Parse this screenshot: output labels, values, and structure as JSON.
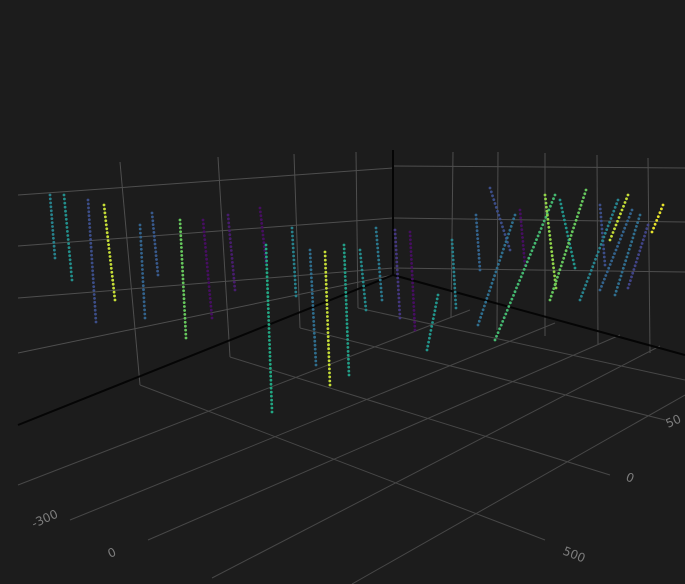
{
  "chart_data": {
    "type": "scatter3d",
    "title": "",
    "background_color": "#1c1c1c",
    "grid": true,
    "colorscale": "viridis",
    "axes": {
      "x": {
        "ticks": [
          {
            "label": "-300",
            "value": -300
          },
          {
            "label": "0",
            "value": 0
          }
        ]
      },
      "y": {
        "ticks": [
          {
            "label": "500",
            "value": 500
          }
        ]
      },
      "z_side": {
        "ticks": [
          {
            "label": "0",
            "value": 0
          },
          {
            "label": "50",
            "value": 50
          }
        ]
      }
    },
    "series": [
      {
        "color_value": 0.55,
        "trace": [
          [
            50,
            195
          ],
          [
            55,
            258
          ]
        ]
      },
      {
        "color_value": 0.62,
        "trace": [
          [
            64,
            195
          ],
          [
            72,
            280
          ]
        ]
      },
      {
        "color_value": 0.3,
        "trace": [
          [
            88,
            200
          ],
          [
            96,
            322
          ]
        ]
      },
      {
        "color_value": 0.95,
        "trace": [
          [
            104,
            205
          ],
          [
            115,
            300
          ]
        ]
      },
      {
        "color_value": 0.4,
        "trace": [
          [
            140,
            225
          ],
          [
            145,
            318
          ]
        ]
      },
      {
        "color_value": 0.35,
        "trace": [
          [
            152,
            213
          ],
          [
            158,
            275
          ]
        ]
      },
      {
        "color_value": 0.85,
        "trace": [
          [
            180,
            220
          ],
          [
            186,
            338
          ]
        ]
      },
      {
        "color_value": 0.05,
        "trace": [
          [
            203,
            220
          ],
          [
            212,
            318
          ]
        ]
      },
      {
        "color_value": 0.1,
        "trace": [
          [
            228,
            215
          ],
          [
            235,
            290
          ]
        ]
      },
      {
        "color_value": 0.05,
        "trace": [
          [
            260,
            208
          ],
          [
            266,
            262
          ]
        ]
      },
      {
        "color_value": 0.75,
        "trace": [
          [
            266,
            245
          ],
          [
            272,
            412
          ]
        ]
      },
      {
        "color_value": 0.55,
        "trace": [
          [
            292,
            228
          ],
          [
            296,
            296
          ]
        ]
      },
      {
        "color_value": 0.45,
        "trace": [
          [
            310,
            250
          ],
          [
            316,
            365
          ]
        ]
      },
      {
        "color_value": 0.95,
        "trace": [
          [
            325,
            252
          ],
          [
            330,
            385
          ]
        ]
      },
      {
        "color_value": 0.7,
        "trace": [
          [
            344,
            245
          ],
          [
            349,
            375
          ]
        ]
      },
      {
        "color_value": 0.6,
        "trace": [
          [
            360,
            250
          ],
          [
            366,
            310
          ]
        ]
      },
      {
        "color_value": 0.5,
        "trace": [
          [
            376,
            228
          ],
          [
            382,
            300
          ]
        ]
      },
      {
        "color_value": 0.2,
        "trace": [
          [
            395,
            230
          ],
          [
            400,
            318
          ]
        ]
      },
      {
        "color_value": 0.05,
        "trace": [
          [
            410,
            232
          ],
          [
            415,
            330
          ]
        ]
      },
      {
        "color_value": 0.65,
        "trace": [
          [
            438,
            295
          ],
          [
            427,
            350
          ]
        ]
      },
      {
        "color_value": 0.55,
        "trace": [
          [
            452,
            240
          ],
          [
            456,
            308
          ]
        ]
      },
      {
        "color_value": 0.4,
        "trace": [
          [
            476,
            215
          ],
          [
            480,
            270
          ]
        ]
      },
      {
        "color_value": 0.3,
        "trace": [
          [
            490,
            188
          ],
          [
            510,
            250
          ]
        ]
      },
      {
        "color_value": 0.45,
        "trace": [
          [
            515,
            215
          ],
          [
            478,
            325
          ]
        ]
      },
      {
        "color_value": 0.05,
        "trace": [
          [
            520,
            210
          ],
          [
            525,
            265
          ]
        ]
      },
      {
        "color_value": 0.8,
        "trace": [
          [
            555,
            195
          ],
          [
            495,
            340
          ]
        ]
      },
      {
        "color_value": 0.9,
        "trace": [
          [
            545,
            195
          ],
          [
            556,
            288
          ]
        ]
      },
      {
        "color_value": 0.65,
        "trace": [
          [
            560,
            200
          ],
          [
            575,
            268
          ]
        ]
      },
      {
        "color_value": 0.85,
        "trace": [
          [
            586,
            190
          ],
          [
            550,
            300
          ]
        ]
      },
      {
        "color_value": 0.3,
        "trace": [
          [
            600,
            205
          ],
          [
            605,
            265
          ]
        ]
      },
      {
        "color_value": 0.55,
        "trace": [
          [
            618,
            200
          ],
          [
            580,
            300
          ]
        ]
      },
      {
        "color_value": 0.4,
        "trace": [
          [
            632,
            210
          ],
          [
            600,
            290
          ]
        ]
      },
      {
        "color_value": 0.95,
        "trace": [
          [
            628,
            195
          ],
          [
            610,
            240
          ]
        ]
      },
      {
        "color_value": 0.45,
        "trace": [
          [
            640,
            215
          ],
          [
            615,
            295
          ]
        ]
      },
      {
        "color_value": 0.25,
        "trace": [
          [
            648,
            225
          ],
          [
            628,
            288
          ]
        ]
      },
      {
        "color_value": 0.98,
        "trace": [
          [
            663,
            205
          ],
          [
            652,
            232
          ]
        ]
      }
    ]
  }
}
